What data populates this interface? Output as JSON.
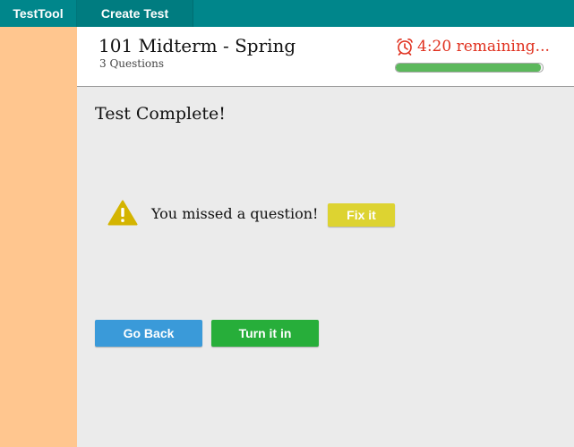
{
  "nav": {
    "brand": "TestTool",
    "create_test": "Create Test"
  },
  "header": {
    "title": "101 Midterm - Spring",
    "subtitle": "3 Questions",
    "timer_text": "4:20 remaining...",
    "timer_icon": "alarm-clock-icon",
    "progress_percent": 99
  },
  "main": {
    "heading": "Test Complete!",
    "warning_icon": "warning-triangle-icon",
    "warning_text": "You missed a question!",
    "fix_label": "Fix it",
    "back_label": "Go Back",
    "turn_in_label": "Turn it in"
  },
  "colors": {
    "topbar": "#00868b",
    "sidebar": "#ffc68f",
    "timer": "#e0301e",
    "progress": "#5cb85c",
    "warning": "#d4b400",
    "fix_button": "#ddd331",
    "back_button": "#3a9ad9",
    "turn_in_button": "#27ae3a"
  }
}
